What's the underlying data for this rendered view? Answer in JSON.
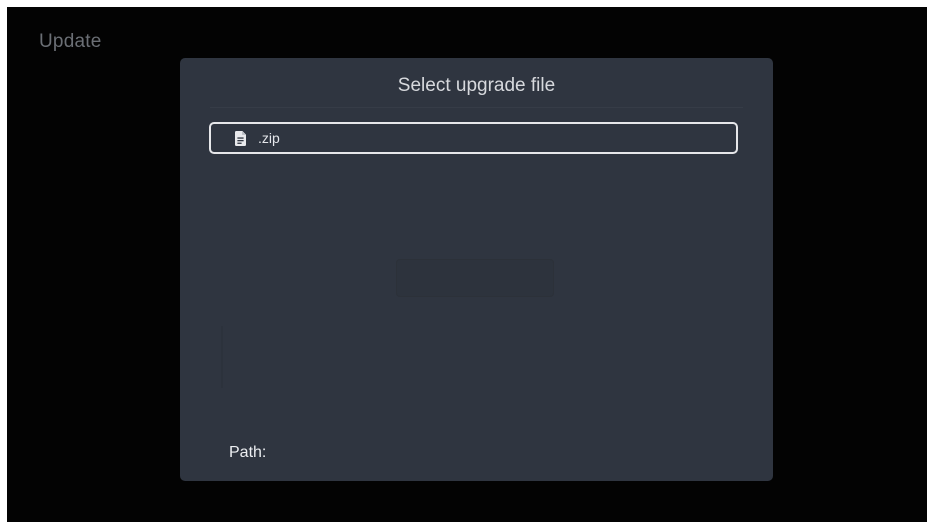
{
  "screen": {
    "title": "Update"
  },
  "dialog": {
    "title": "Select upgrade file",
    "files": [
      {
        "name": ".zip",
        "icon": "document-icon"
      }
    ],
    "path_label": "Path:"
  },
  "colors": {
    "background": "#030303",
    "dialog_background": "#2f3540",
    "focus_border": "#e6e7ea",
    "title_text": "#d7d9dd",
    "muted_title": "#6b6f75"
  }
}
